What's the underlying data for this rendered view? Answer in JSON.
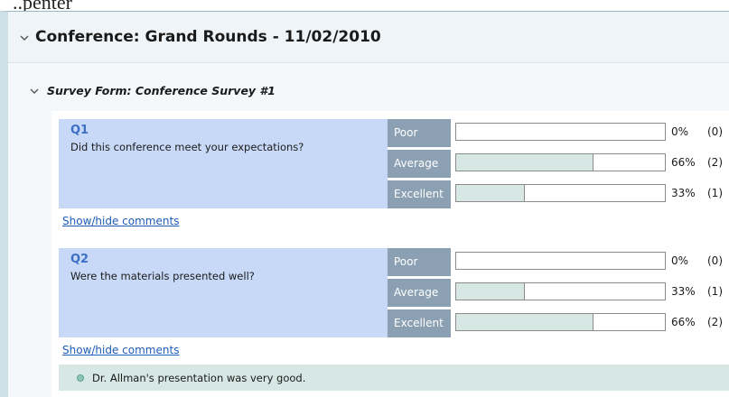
{
  "top_partial_text": "..penter",
  "conference": {
    "title": "Conference: Grand Rounds - 11/02/2010"
  },
  "survey": {
    "title": "Survey Form: Conference Survey #1",
    "show_hide_label": "Show/hide comments",
    "questions": [
      {
        "number": "Q1",
        "text": "Did this conference meet your expectations?",
        "ratings": [
          {
            "label": "Poor",
            "percent": "0%",
            "count": "(0)",
            "fraction": 0.0
          },
          {
            "label": "Average",
            "percent": "66%",
            "count": "(2)",
            "fraction": 0.66
          },
          {
            "label": "Excellent",
            "percent": "33%",
            "count": "(1)",
            "fraction": 0.33
          }
        ],
        "comments": []
      },
      {
        "number": "Q2",
        "text": "Were the materials presented well?",
        "ratings": [
          {
            "label": "Poor",
            "percent": "0%",
            "count": "(0)",
            "fraction": 0.0
          },
          {
            "label": "Average",
            "percent": "33%",
            "count": "(1)",
            "fraction": 0.33
          },
          {
            "label": "Excellent",
            "percent": "66%",
            "count": "(2)",
            "fraction": 0.66
          }
        ],
        "comments": [
          "Dr. Allman's presentation was very good."
        ]
      }
    ]
  },
  "icons": {
    "conference_toggle": "chevron-down-icon",
    "survey_toggle": "chevron-down-icon",
    "comment_bullet": "bullet-icon"
  },
  "colors": {
    "question_panel": "#c8d9f8",
    "rating_label_bg": "#8ba0b3",
    "bar_fill": "#d6e7e4",
    "link": "#1e5bb8"
  }
}
